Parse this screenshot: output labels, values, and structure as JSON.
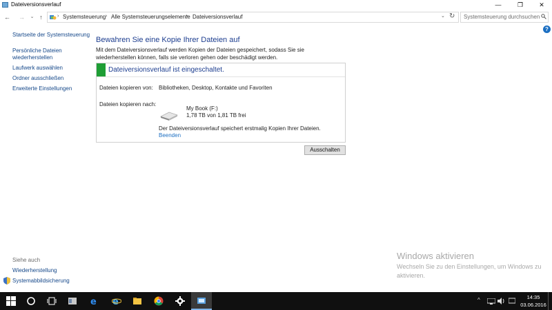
{
  "window": {
    "title": "Dateiversionsverlauf",
    "minimize": "—",
    "maximize": "❐",
    "close": "✕"
  },
  "nav": {
    "back": "←",
    "forward": "→",
    "recent": "⌄",
    "up": "↑",
    "dropdown": "⌄",
    "refresh": "↻"
  },
  "breadcrumb": [
    "Systemsteuerung",
    "Alle Systemsteuerungselemente",
    "Dateiversionsverlauf"
  ],
  "breadcrumb_sep": "›",
  "search": {
    "placeholder": "Systemsteuerung durchsuchen"
  },
  "help": "?",
  "sidebar": {
    "items": [
      {
        "label": "Startseite der Systemsteuerung"
      },
      {
        "label": "Persönliche Dateien"
      },
      {
        "label": "wiederherstellen"
      },
      {
        "label": "Laufwerk auswählen"
      },
      {
        "label": "Ordner ausschließen"
      },
      {
        "label": "Erweiterte Einstellungen"
      }
    ],
    "see_also": "Siehe auch",
    "links": [
      {
        "label": "Wiederherstellung"
      },
      {
        "label": "Systemabbildsicherung"
      }
    ]
  },
  "main": {
    "heading": "Bewahren Sie eine Kopie Ihrer Dateien auf",
    "description": "Mit dem Dateiversionsverlauf werden Kopien der Dateien gespeichert, sodass Sie sie wiederherstellen können, falls sie verloren gehen oder beschädigt werden.",
    "status": "Dateiversionsverlauf ist eingeschaltet.",
    "status_color": "#1e9e35",
    "copy_from_label": "Dateien kopieren von:",
    "copy_from_value": "Bibliotheken, Desktop, Kontakte und Favoriten",
    "copy_to_label": "Dateien kopieren nach:",
    "drive_name": "My Book (F:)",
    "drive_space": "1,78 TB von 1,81 TB frei",
    "info": "Der Dateiversionsverlauf speichert erstmalig Kopien Ihrer Dateien.",
    "stop_link": "Beenden",
    "off_button": "Ausschalten"
  },
  "watermark": {
    "title": "Windows aktivieren",
    "text": "Wechseln Sie zu den Einstellungen, um Windows zu aktivieren."
  },
  "taskbar": {
    "icons": [
      "windows-start-icon",
      "cortana-icon",
      "task-view-icon",
      "file-explorer-icon",
      "edge-icon",
      "internet-explorer-icon",
      "folder-icon",
      "chrome-icon",
      "settings-icon",
      "control-panel-icon"
    ],
    "tray": {
      "chevron": "^"
    },
    "time": "14:35",
    "date": "03.06.2016"
  }
}
